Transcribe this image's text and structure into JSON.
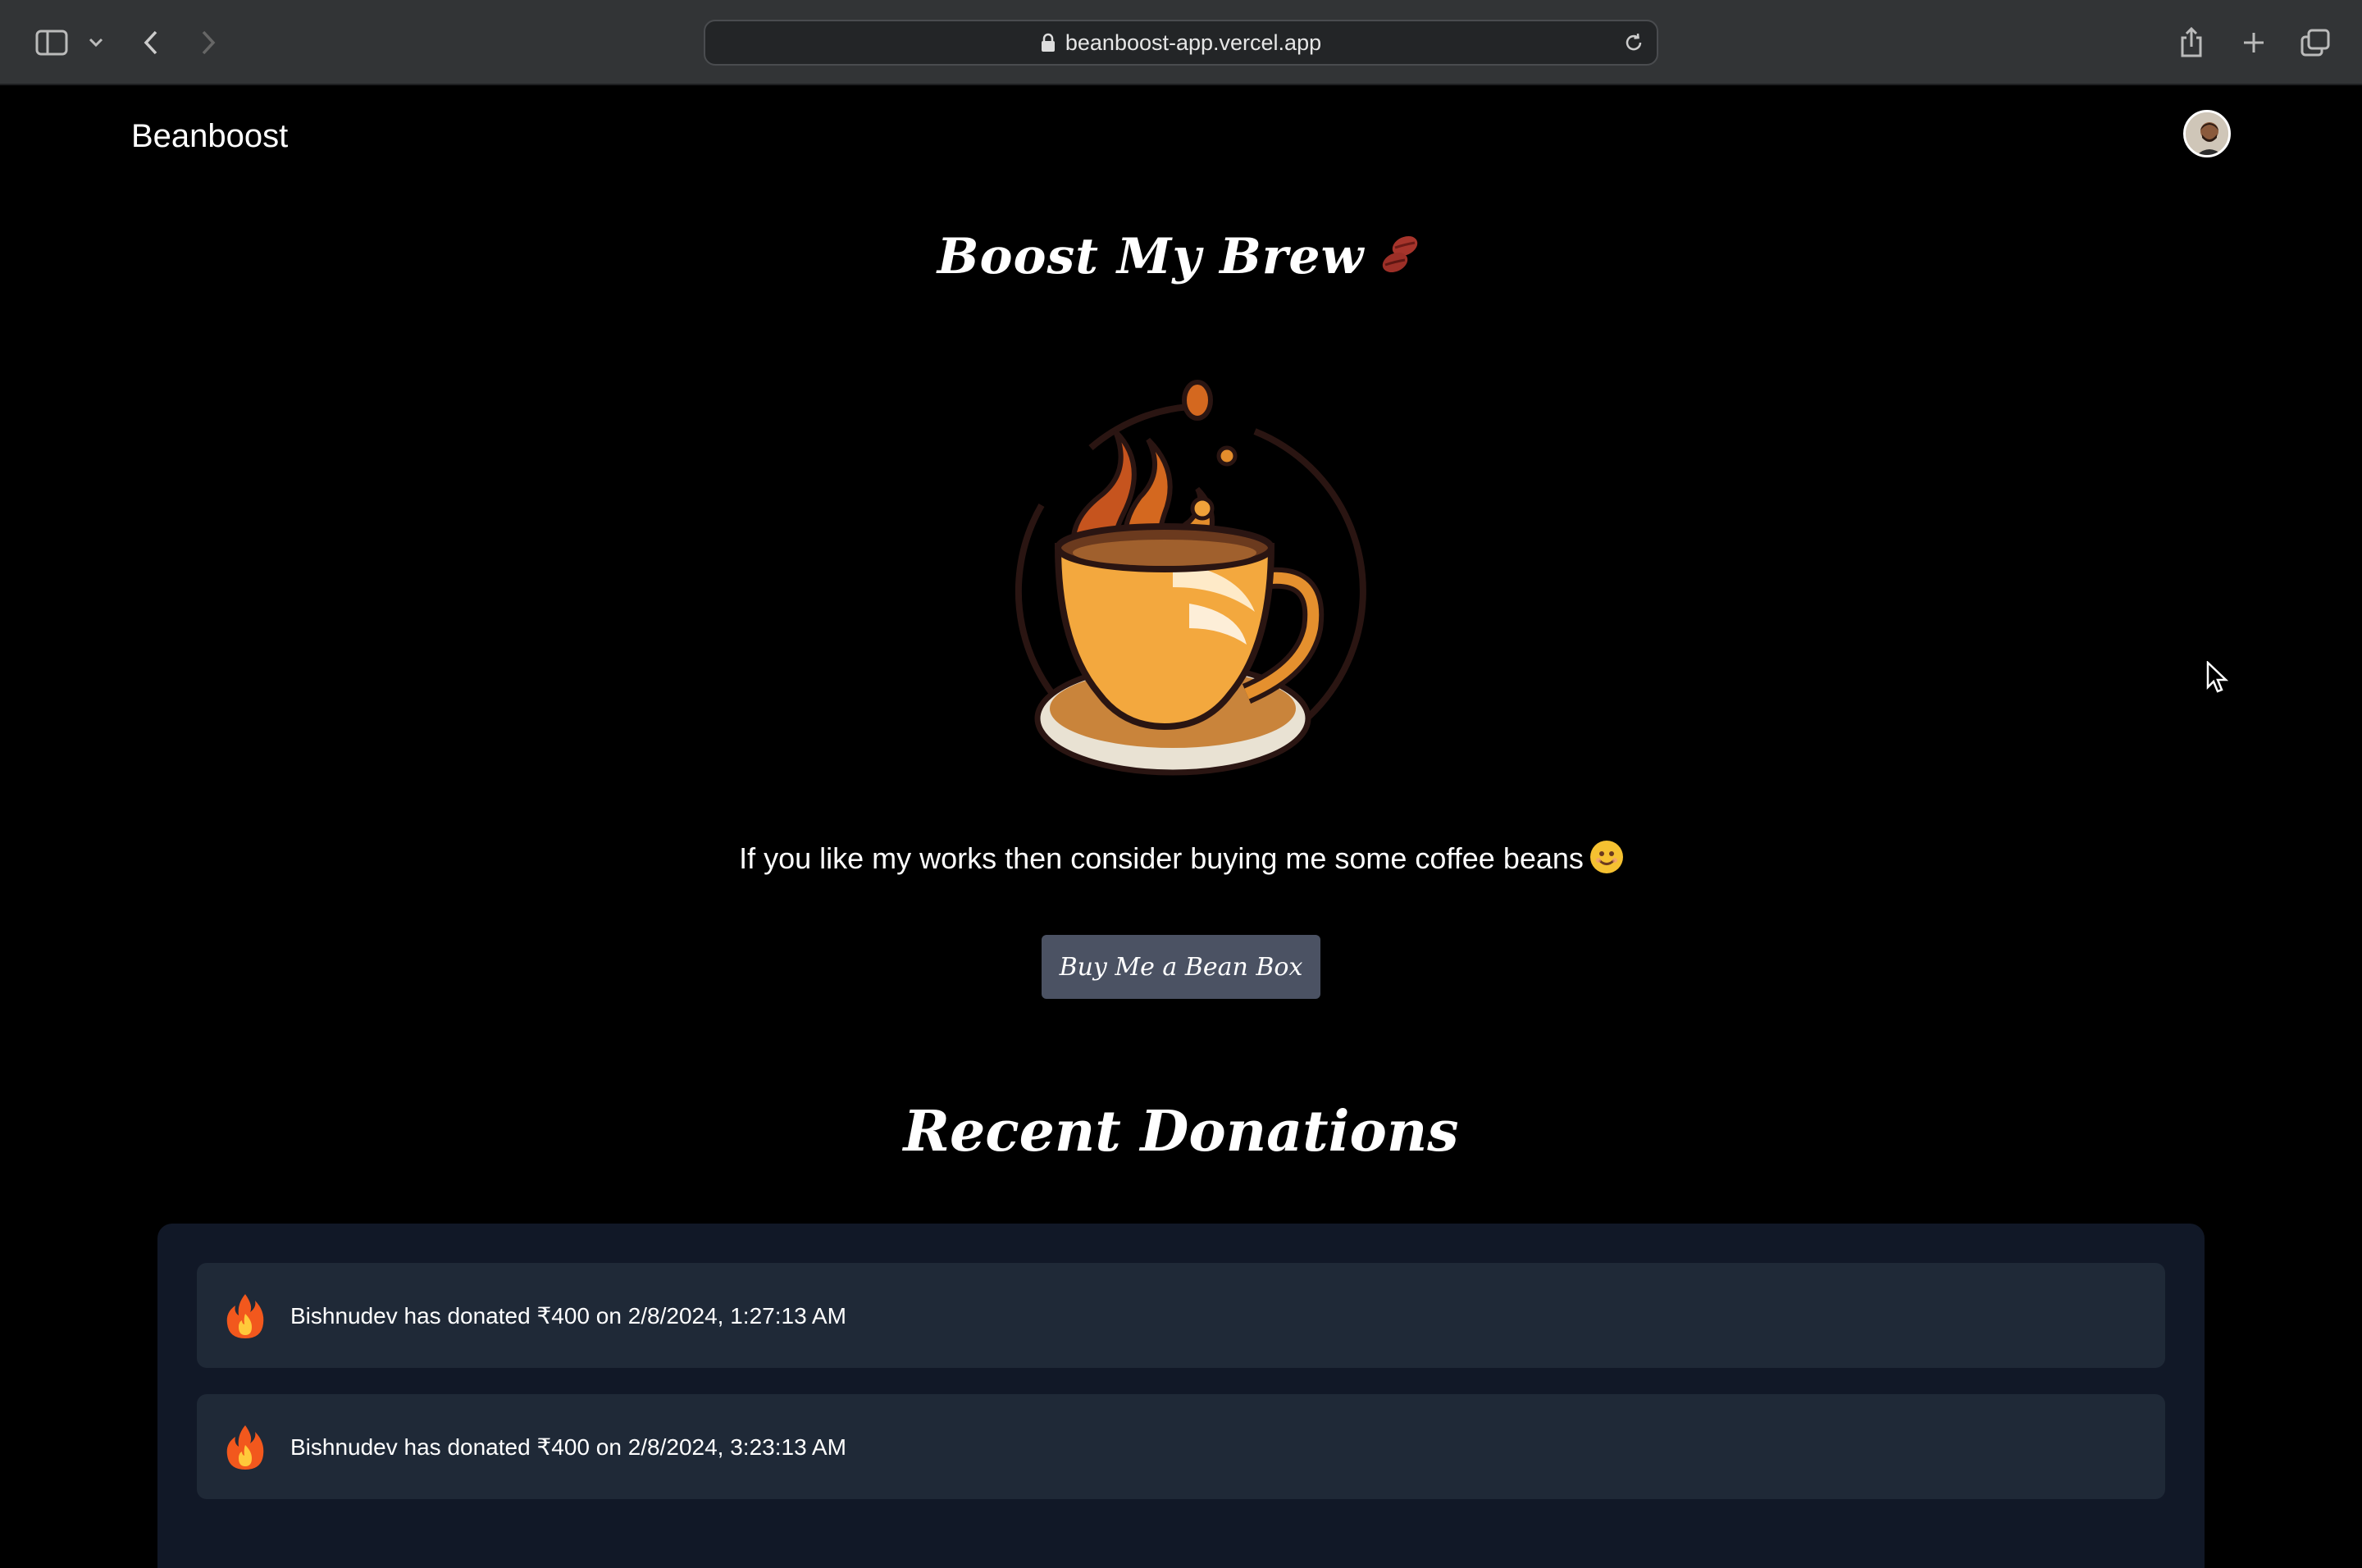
{
  "browser": {
    "url": "beanboost-app.vercel.app"
  },
  "header": {
    "brand": "Beanboost"
  },
  "hero": {
    "title": "Boost My Brew",
    "tagline": "If you like my works then consider buying me some coffee beans",
    "button_label": "Buy Me a Bean Box"
  },
  "donations": {
    "title": "Recent Donations",
    "items": [
      {
        "text": "Bishnudev has donated ₹400 on 2/8/2024, 1:27:13 AM"
      },
      {
        "text": "Bishnudev has donated ₹400 on 2/8/2024, 3:23:13 AM"
      }
    ]
  },
  "colors": {
    "page_bg": "#000000",
    "button_bg": "#4b5263",
    "panel_bg": "#111827",
    "card_bg": "#1f2937"
  }
}
